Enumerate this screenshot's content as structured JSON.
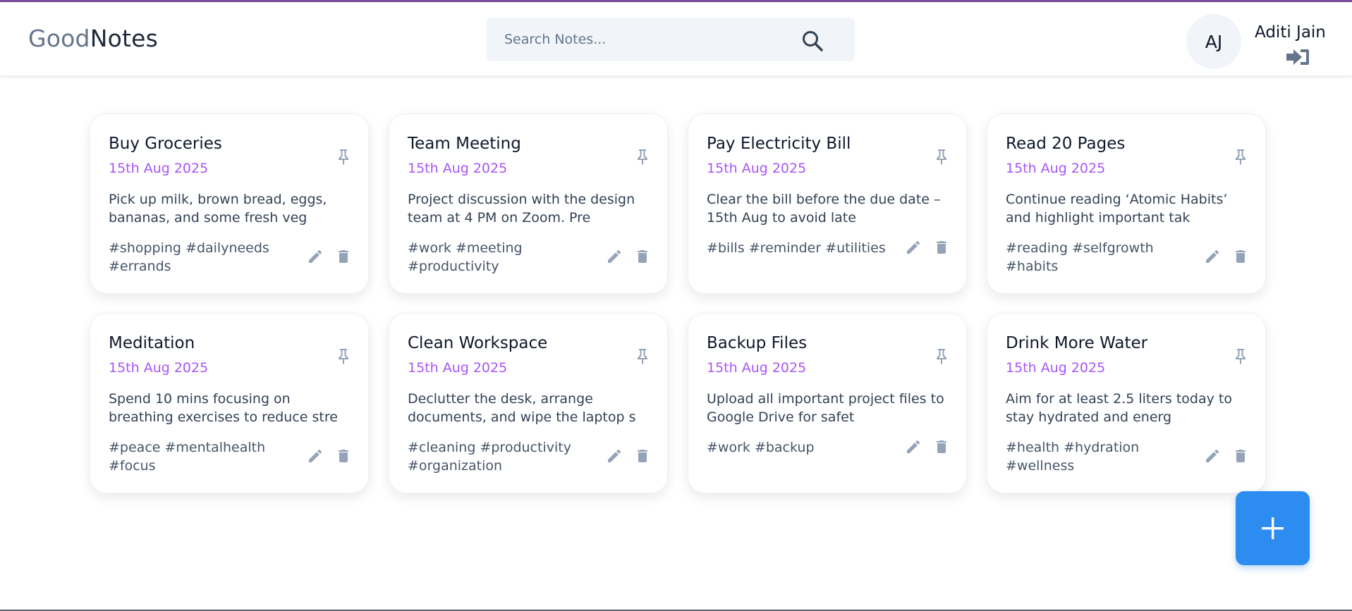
{
  "app": {
    "logo_part1": "Good",
    "logo_part2": "Notes"
  },
  "search": {
    "placeholder": "Search Notes..."
  },
  "user": {
    "initials": "AJ",
    "name": "Aditi Jain"
  },
  "icons": {
    "search": "search-icon",
    "logout": "logout-icon",
    "pin": "pin-icon",
    "edit": "pencil-icon",
    "delete": "trash-icon",
    "add": "plus-icon"
  },
  "colors": {
    "date": "#a855f7",
    "fab": "#2d8cf0",
    "accent_bar": "#7c4d9c"
  },
  "notes": [
    {
      "title": "Buy Groceries",
      "date": "15th Aug 2025",
      "content": "Pick up milk, brown bread, eggs, bananas, and some fresh veg",
      "tags": "#shopping #dailyneeds #errands"
    },
    {
      "title": "Team Meeting",
      "date": "15th Aug 2025",
      "content": "Project discussion with the design team at 4 PM on Zoom. Pre",
      "tags": "#work #meeting #productivity"
    },
    {
      "title": "Pay Electricity Bill",
      "date": "15th Aug 2025",
      "content": "Clear the bill before the due date – 15th Aug to avoid late",
      "tags": "#bills #reminder #utilities"
    },
    {
      "title": "Read 20 Pages",
      "date": "15th Aug 2025",
      "content": "Continue reading ‘Atomic Habits’ and highlight important tak",
      "tags": "#reading #selfgrowth #habits"
    },
    {
      "title": "Meditation",
      "date": "15th Aug 2025",
      "content": "Spend 10 mins focusing on breathing exercises to reduce stre",
      "tags": "#peace #mentalhealth #focus"
    },
    {
      "title": "Clean Workspace",
      "date": "15th Aug 2025",
      "content": "Declutter the desk, arrange documents, and wipe the laptop s",
      "tags": "#cleaning #productivity #organization"
    },
    {
      "title": "Backup Files",
      "date": "15th Aug 2025",
      "content": "Upload all important project files to Google Drive for safet",
      "tags": "#work #backup"
    },
    {
      "title": "Drink More Water",
      "date": "15th Aug 2025",
      "content": "Aim for at least 2.5 liters today to stay hydrated and energ",
      "tags": "#health #hydration #wellness"
    }
  ]
}
